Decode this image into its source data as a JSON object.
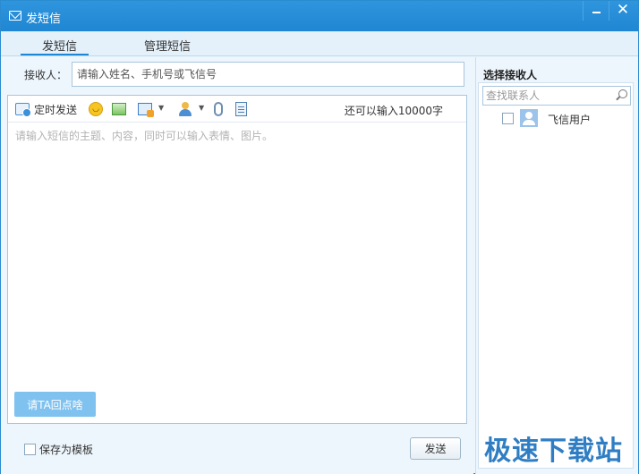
{
  "window": {
    "title": "发短信",
    "minimize": "—",
    "close": "✕"
  },
  "tabs": [
    {
      "label": "发短信",
      "active": true
    },
    {
      "label": "管理短信",
      "active": false
    }
  ],
  "recipient": {
    "label": "接收人：",
    "placeholder": "请输入姓名、手机号或飞信号"
  },
  "toolbar": {
    "timer_label": "定时发送",
    "remaining": "还可以输入10000字",
    "icons": [
      "timer-icon",
      "emoji-icon",
      "image-icon",
      "screenshot-icon",
      "contact-card-icon",
      "attachment-icon",
      "template-icon"
    ]
  },
  "message": {
    "placeholder": "请输入短信的主题、内容，同时可以输入表情、图片。",
    "nudge_label": "请TA回点啥"
  },
  "footer": {
    "save_template_label": "保存为模板",
    "send_label": "发送"
  },
  "sidebar": {
    "title": "选择接收人",
    "search_placeholder": "查找联系人",
    "contacts": [
      {
        "name": "飞信用户"
      }
    ]
  },
  "watermark": "极速下载站",
  "colors": {
    "titlebar": "#2f95dd",
    "accent": "#1e88d6",
    "nudge_button": "#7fc2f0"
  }
}
